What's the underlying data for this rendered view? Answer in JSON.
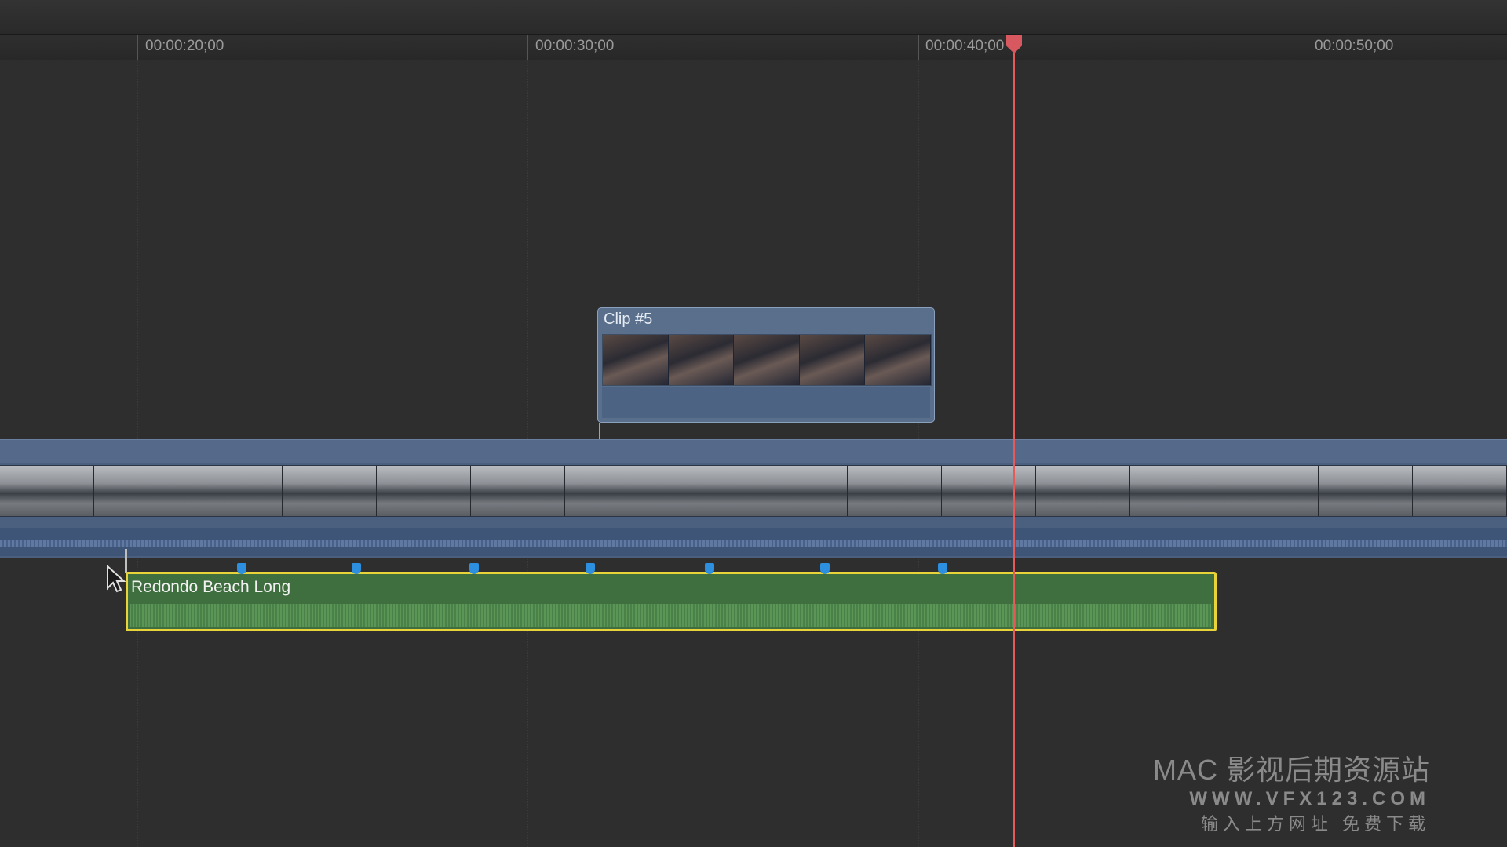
{
  "ruler": {
    "timecodes": [
      "00:00:20;00",
      "00:00:30;00",
      "00:00:40;00",
      "00:00:50;00"
    ]
  },
  "connected_clip": {
    "title": "Clip #5",
    "frame_count": 5
  },
  "primary_storyline": {
    "frame_count": 16
  },
  "audio_clip": {
    "title": "Redondo Beach Long",
    "marker_count": 7,
    "highlight_color": "#e8d43a",
    "fill_color": "#3f6e3f"
  },
  "playhead": {
    "color": "#e85a5a"
  },
  "watermark": {
    "line1": "MAC 影视后期资源站",
    "line2": "WWW.VFX123.COM",
    "line3": "输入上方网址 免费下载"
  },
  "icons": {
    "pointer": "arrow-cursor-icon",
    "playhead": "playhead-icon",
    "marker": "marker-icon"
  }
}
